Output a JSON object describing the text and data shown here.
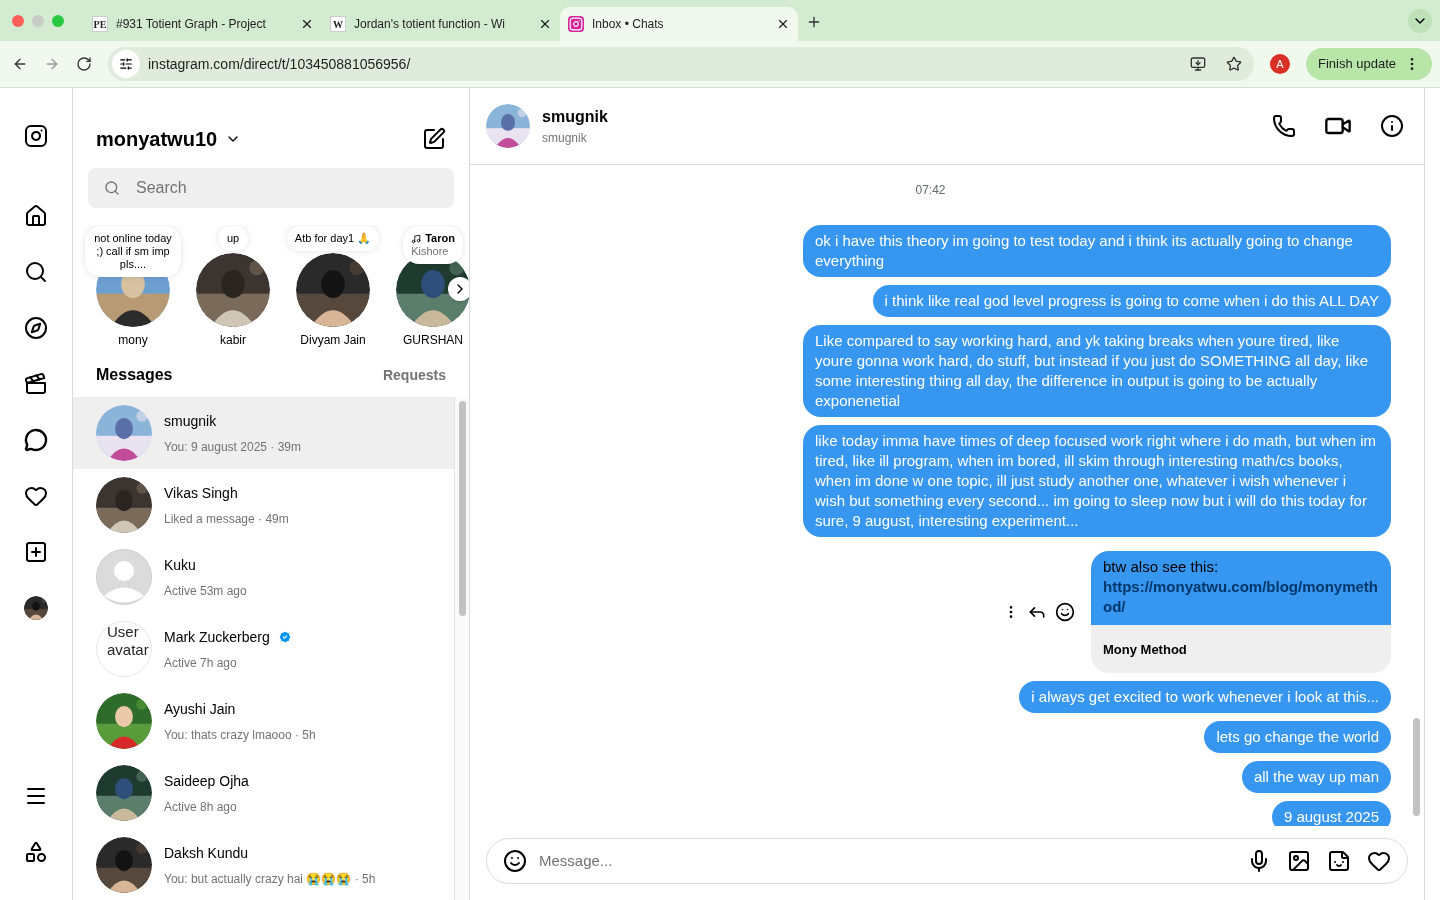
{
  "browser": {
    "tabs": [
      {
        "title": "#931 Totient Graph - Project",
        "logo_text": "PE",
        "selected": false
      },
      {
        "title": "Jordan's totient function - Wi",
        "logo_text": "W",
        "selected": false
      },
      {
        "title": "Inbox • Chats",
        "selected": true
      }
    ],
    "url": "instagram.com/direct/t/103450881056956/",
    "profile_initial": "A",
    "update_button": "Finish update"
  },
  "inbox": {
    "username": "monyatwu10",
    "search_placeholder": "Search",
    "notes": [
      {
        "note": "not online today ;) call if sm imp pls....",
        "name": "mony"
      },
      {
        "note": "up",
        "name": "kabir"
      },
      {
        "note": "Atb for day1 🙏",
        "name": "Divyam Jain"
      },
      {
        "note": "Taron",
        "note_sub": "Kishore",
        "name": "GURSHAN"
      }
    ],
    "messages_heading": "Messages",
    "requests_label": "Requests",
    "conversations": [
      {
        "name": "smugnik",
        "preview": "You: 9 august 2025 · 39m",
        "selected": true,
        "verified": false
      },
      {
        "name": "Vikas Singh",
        "preview": "Liked a message · 49m",
        "selected": false,
        "verified": false
      },
      {
        "name": "Kuku",
        "preview": "Active 53m ago",
        "avatar": {
          "kind": "default"
        },
        "selected": false,
        "verified": false
      },
      {
        "name": "Mark Zuckerberg",
        "preview": "Active 7h ago",
        "avatar": {
          "kind": "broken",
          "alt": "User avatar"
        },
        "selected": false,
        "verified": true
      },
      {
        "name": "Ayushi Jain",
        "preview": "You: thats crazy lmaooo · 5h",
        "selected": false,
        "verified": false
      },
      {
        "name": "Saideep Ojha",
        "preview": "Active 8h ago",
        "selected": false,
        "verified": false
      },
      {
        "name": "Daksh Kundu",
        "preview": "You: but actually crazy hai 😭😭😭 · 5h",
        "selected": false,
        "verified": false
      }
    ]
  },
  "chat": {
    "name": "smugnik",
    "username": "smugnik",
    "timestamp": "07:42",
    "messages": [
      {
        "kind": "text",
        "text": "ok i have this theory im going to test today and i think its actually going to change everything"
      },
      {
        "kind": "text",
        "text": "i think like real god level progress is going to come when i do this ALL DAY"
      },
      {
        "kind": "text",
        "text": "Like compared to say working hard, and yk taking breaks when youre tired, like youre gonna work hard, do stuff, but instead if you just do SOMETHING all day, like some interesting thing all day, the difference in output is going to be actually exponenetial"
      },
      {
        "kind": "text",
        "text": "like today imma have times of deep focused work right where i do math, but when im tired, like ill program, when im bored, ill skim through interesting math/cs books, when im done w one topic, ill just study another one, whatever i wish whenever i wish but something every second... im going to sleep now but i will do this today for sure, 9 august, interesting experiment..."
      },
      {
        "kind": "link",
        "text": "btw also see this:",
        "link": "https://monyatwu.com/blog/monymethod/",
        "preview_title": "Mony Method"
      },
      {
        "kind": "text",
        "text": "i always get excited to work whenever i look at this..."
      },
      {
        "kind": "text",
        "text": "lets go change the world"
      },
      {
        "kind": "text",
        "text": "all the way up man"
      },
      {
        "kind": "text",
        "text": "9 august 2025"
      }
    ],
    "input_placeholder": "Message..."
  }
}
